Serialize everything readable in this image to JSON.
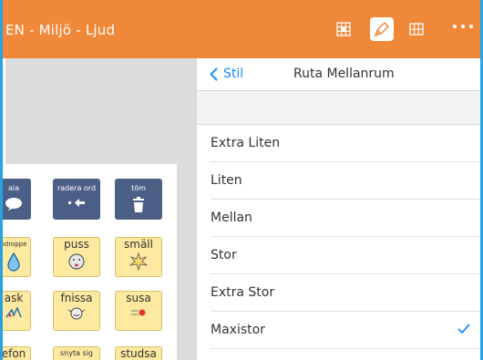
{
  "window": {
    "title": "EN - Miljö - Ljud"
  },
  "toolbar": {
    "buttons": [
      {
        "name": "grid-edit-icon",
        "active": false
      },
      {
        "name": "brush-icon",
        "active": true
      },
      {
        "name": "grid-icon",
        "active": false
      },
      {
        "name": "more-icon",
        "active": false
      }
    ]
  },
  "board": {
    "row1": [
      {
        "label": "ala",
        "icon": "speech-bubble-icon"
      },
      {
        "label": "radera ord",
        "icon": "delete-word-icon"
      },
      {
        "label": "töm",
        "icon": "trash-icon"
      }
    ],
    "row2": [
      {
        "label": "ndroppe",
        "icon": "drop-icon"
      },
      {
        "label": "puss",
        "icon": "kiss-icon"
      },
      {
        "label": "smäll",
        "icon": "bang-icon"
      }
    ],
    "row3": [
      {
        "label": "ask",
        "icon": "splash-icon"
      },
      {
        "label": "fnissa",
        "icon": "giggle-icon"
      },
      {
        "label": "susa",
        "icon": "whoosh-icon"
      }
    ],
    "row4": [
      {
        "label": "efon"
      },
      {
        "label": "snyta sig"
      },
      {
        "label": "studsa"
      }
    ]
  },
  "settings": {
    "back_label": "Stil",
    "title": "Ruta Mellanrum",
    "options": [
      {
        "label": "Extra Liten",
        "selected": false
      },
      {
        "label": "Liten",
        "selected": false
      },
      {
        "label": "Mellan",
        "selected": false
      },
      {
        "label": "Stor",
        "selected": false
      },
      {
        "label": "Extra Stor",
        "selected": false
      },
      {
        "label": "Maxistor",
        "selected": true
      }
    ]
  },
  "colors": {
    "topbar": "#f0883a",
    "accent": "#1a8cff",
    "frame": "#29a3e0",
    "dark_cell": "#4c5f86",
    "yellow_cell": "#fde9a0"
  }
}
